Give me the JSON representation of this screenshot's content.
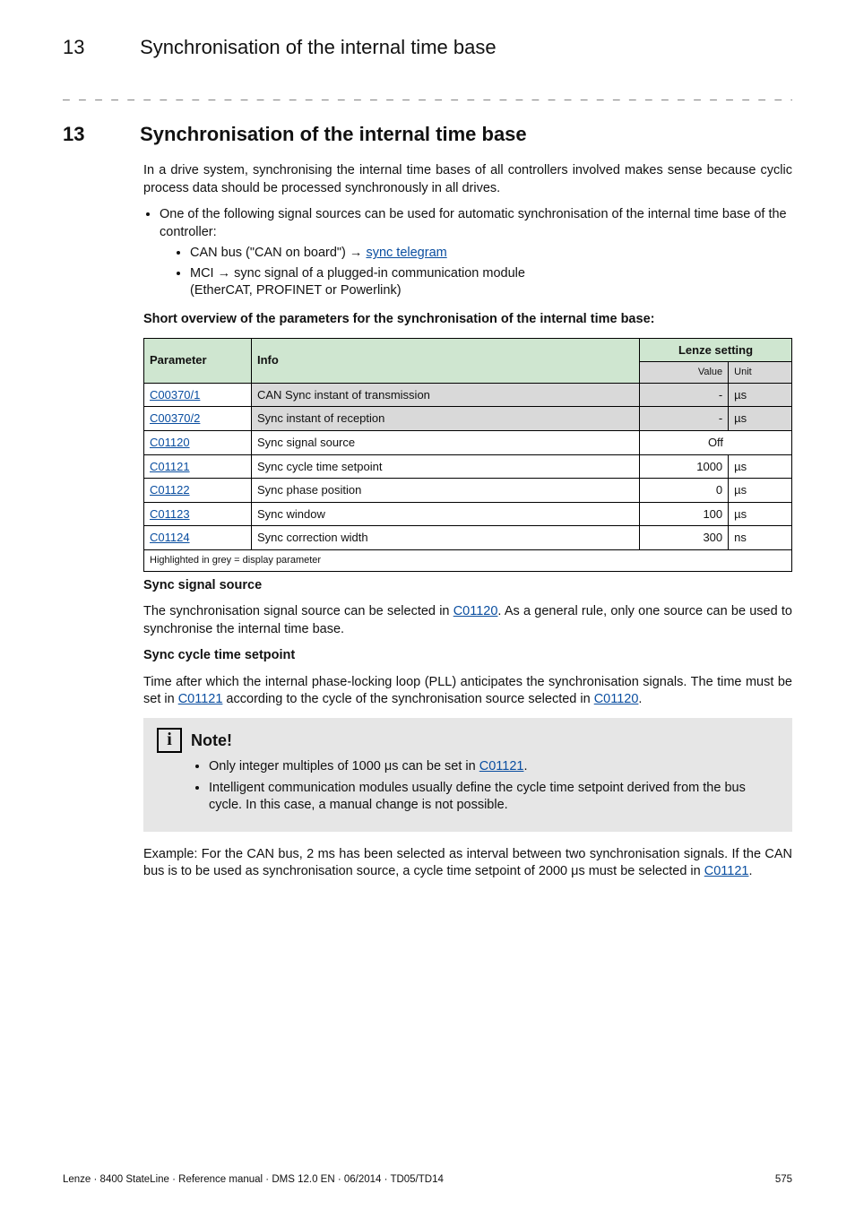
{
  "runningHead": {
    "number": "13",
    "title": "Synchronisation of the internal time base"
  },
  "divider": "_ _ _ _ _ _ _ _ _ _ _ _ _ _ _ _ _ _ _ _ _ _ _ _ _ _ _ _ _ _ _ _ _ _ _ _ _ _ _ _ _ _ _ _ _ _ _ _ _ _ _ _ _ _ _ _ _ _ _ _ _ _ _ _",
  "sectionTitle": {
    "number": "13",
    "title": "Synchronisation of the internal time base"
  },
  "intro": "In a drive system, synchronising the internal time bases of all controllers involved makes sense because cyclic process data should be processed synchronously in all drives.",
  "bullet1": "One of the following signal sources can be used for automatic synchronisation of the internal time base of the controller:",
  "sub1_prefix": "CAN bus (\"CAN on board\") → ",
  "sub1_link": "sync telegram",
  "sub2_line1": "MCI → sync signal of a plugged-in communication module",
  "sub2_line2": "(EtherCAT, PROFINET or Powerlink)",
  "shortOverviewHead": "Short overview of the parameters for the synchronisation of the internal time base:",
  "table": {
    "headers": {
      "param": "Parameter",
      "info": "Info",
      "lenze": "Lenze setting",
      "value": "Value",
      "unit": "Unit"
    },
    "rows": [
      {
        "param": "C00370/1",
        "info": "CAN Sync instant of transmission",
        "value": "-",
        "unit": "µs",
        "display": true
      },
      {
        "param": "C00370/2",
        "info": "Sync instant of reception",
        "value": "-",
        "unit": "µs",
        "display": true
      },
      {
        "param": "C01120",
        "info": "Sync signal source",
        "value": "Off",
        "unit": "",
        "span": true
      },
      {
        "param": "C01121",
        "info": "Sync cycle time setpoint",
        "value": "1000",
        "unit": "µs"
      },
      {
        "param": "C01122",
        "info": "Sync phase position",
        "value": "0",
        "unit": "µs"
      },
      {
        "param": "C01123",
        "info": "Sync window",
        "value": "100",
        "unit": "µs"
      },
      {
        "param": "C01124",
        "info": "Sync correction width",
        "value": "300",
        "unit": "ns"
      }
    ],
    "footnote": "Highlighted in grey = display parameter"
  },
  "syncSource": {
    "head": "Sync signal source",
    "pre": "The synchronisation signal source can be selected in ",
    "link": "C01120",
    "post": ". As a general rule, only one source can be used to synchronise the internal time base."
  },
  "syncCycle": {
    "head": "Sync cycle time setpoint",
    "l1": "Time after which the internal phase-locking loop (PLL) anticipates the synchronisation signals. The time must be set in ",
    "link1": "C01121",
    "l2": " according to the cycle of the synchronisation source selected in ",
    "link2": "C01120",
    "l3": "."
  },
  "note": {
    "title": "Note!",
    "b1_pre": "Only integer multiples of 1000 μs can be set in ",
    "b1_link": "C01121",
    "b1_post": ".",
    "b2": "Intelligent communication modules usually define the cycle time setpoint derived from the bus cycle. In this case, a manual change is not possible."
  },
  "example": {
    "pre": "Example: For the CAN bus, 2 ms has been selected as interval between two synchronisation signals. If the CAN bus is to be used as synchronisation source, a cycle time setpoint of 2000 μs must be selected in ",
    "link": "C01121",
    "post": "."
  },
  "footer": {
    "left": "Lenze · 8400 StateLine · Reference manual · DMS 12.0 EN · 06/2014 · TD05/TD14",
    "right": "575"
  }
}
